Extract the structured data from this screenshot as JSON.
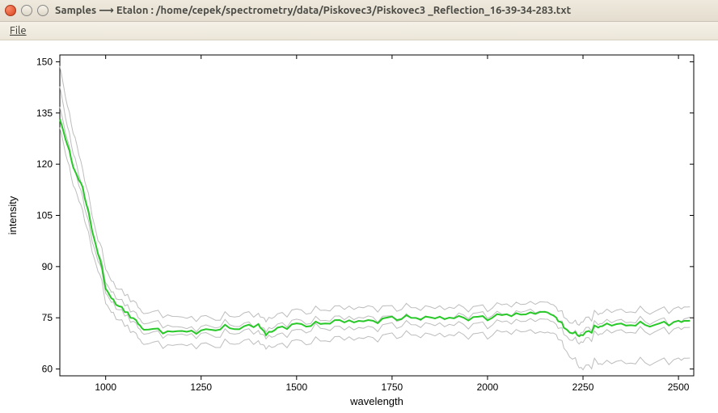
{
  "window": {
    "title": "Samples ⟶ Etalon : /home/cepek/spectrometry/data/Piskovec3/Piskovec3 _Reflection_16-39-34-283.txt"
  },
  "menu": {
    "file": "File"
  },
  "chart_data": {
    "type": "line",
    "xlabel": "wavelength",
    "ylabel": "intensity",
    "xlim": [
      880,
      2540
    ],
    "ylim": [
      58,
      152
    ],
    "xticks": [
      1000,
      1250,
      1500,
      1750,
      2000,
      2250,
      2500
    ],
    "yticks": [
      60,
      75,
      90,
      105,
      120,
      135,
      150
    ],
    "series": [
      {
        "name": "sample-gray-1",
        "color": "#bdbdbd",
        "width": 1,
        "x": [
          880,
          900,
          920,
          940,
          960,
          980,
          1000,
          1020,
          1050,
          1080,
          1100,
          1150,
          1200,
          1250,
          1300,
          1350,
          1400,
          1420,
          1450,
          1500,
          1550,
          1600,
          1650,
          1700,
          1750,
          1800,
          1850,
          1900,
          1950,
          2000,
          2050,
          2100,
          2150,
          2180,
          2200,
          2230,
          2250,
          2280,
          2300,
          2350,
          2400,
          2450,
          2500,
          2530
        ],
        "y": [
          150,
          136,
          128,
          118,
          108,
          98,
          90,
          85,
          82,
          79,
          77,
          76,
          75,
          75,
          75,
          76,
          76,
          74,
          76,
          77,
          77,
          78,
          78,
          78,
          78,
          78,
          78,
          78,
          78,
          78,
          79,
          79,
          80,
          78,
          75,
          73,
          74,
          76,
          77,
          77,
          77,
          77,
          78,
          78
        ]
      },
      {
        "name": "sample-gray-2",
        "color": "#bdbdbd",
        "width": 1,
        "x": [
          880,
          900,
          920,
          940,
          960,
          980,
          1000,
          1020,
          1050,
          1080,
          1100,
          1150,
          1200,
          1250,
          1300,
          1350,
          1400,
          1420,
          1450,
          1500,
          1550,
          1600,
          1650,
          1700,
          1750,
          1800,
          1850,
          1900,
          1950,
          2000,
          2050,
          2100,
          2150,
          2180,
          2200,
          2230,
          2250,
          2280,
          2300,
          2350,
          2400,
          2450,
          2500,
          2530
        ],
        "y": [
          144,
          130,
          122,
          112,
          104,
          94,
          86,
          82,
          79,
          76,
          74,
          73,
          72,
          72,
          73,
          73,
          73,
          71,
          73,
          74,
          74,
          75,
          75,
          75,
          75,
          75,
          75,
          75,
          76,
          76,
          76,
          77,
          77,
          75,
          72,
          70,
          71,
          73,
          74,
          74,
          74,
          74,
          74,
          75
        ]
      },
      {
        "name": "sample-gray-3",
        "color": "#bdbdbd",
        "width": 1,
        "x": [
          880,
          900,
          920,
          940,
          960,
          980,
          1000,
          1020,
          1050,
          1080,
          1100,
          1150,
          1200,
          1250,
          1300,
          1350,
          1400,
          1420,
          1450,
          1500,
          1550,
          1600,
          1650,
          1700,
          1750,
          1800,
          1850,
          1900,
          1950,
          2000,
          2050,
          2100,
          2150,
          2180,
          2200,
          2230,
          2250,
          2280,
          2300,
          2350,
          2400,
          2450,
          2500,
          2530
        ],
        "y": [
          138,
          126,
          118,
          110,
          100,
          92,
          83,
          79,
          76,
          73,
          71,
          70,
          70,
          70,
          70,
          71,
          71,
          69,
          70,
          71,
          72,
          72,
          72,
          72,
          73,
          73,
          73,
          73,
          73,
          73,
          74,
          74,
          75,
          73,
          70,
          68,
          68,
          70,
          71,
          71,
          71,
          71,
          72,
          72
        ]
      },
      {
        "name": "sample-gray-4",
        "color": "#bdbdbd",
        "width": 1,
        "x": [
          880,
          900,
          920,
          940,
          960,
          980,
          1000,
          1020,
          1050,
          1080,
          1100,
          1150,
          1200,
          1250,
          1300,
          1350,
          1400,
          1420,
          1450,
          1500,
          1550,
          1600,
          1650,
          1700,
          1750,
          1800,
          1850,
          1900,
          1950,
          2000,
          2050,
          2100,
          2150,
          2180,
          2200,
          2230,
          2250,
          2280,
          2300,
          2350,
          2400,
          2450,
          2500,
          2530
        ],
        "y": [
          132,
          120,
          113,
          106,
          97,
          89,
          80,
          76,
          73,
          70,
          68,
          67,
          67,
          67,
          67,
          68,
          68,
          66,
          67,
          68,
          68,
          69,
          69,
          69,
          70,
          70,
          70,
          70,
          70,
          70,
          71,
          71,
          71,
          70,
          66,
          62,
          60,
          62,
          62,
          62,
          62,
          62,
          63,
          63
        ]
      },
      {
        "name": "etalon-green",
        "color": "#28c828",
        "width": 2,
        "x": [
          880,
          900,
          920,
          940,
          960,
          980,
          1000,
          1020,
          1050,
          1080,
          1100,
          1150,
          1200,
          1250,
          1300,
          1350,
          1400,
          1420,
          1450,
          1500,
          1550,
          1600,
          1650,
          1700,
          1750,
          1800,
          1850,
          1900,
          1950,
          2000,
          2050,
          2100,
          2150,
          2180,
          2200,
          2230,
          2250,
          2280,
          2300,
          2350,
          2400,
          2450,
          2500,
          2530
        ],
        "y": [
          134,
          125,
          118,
          113,
          103,
          94,
          84,
          80,
          77,
          74,
          72,
          71,
          71,
          71,
          72,
          72,
          73,
          70,
          72,
          73,
          73,
          74,
          74,
          74,
          75,
          75,
          75,
          75,
          75,
          75,
          76,
          76,
          77,
          75,
          72,
          70,
          70,
          72,
          73,
          73,
          73,
          73,
          74,
          74
        ]
      }
    ]
  }
}
